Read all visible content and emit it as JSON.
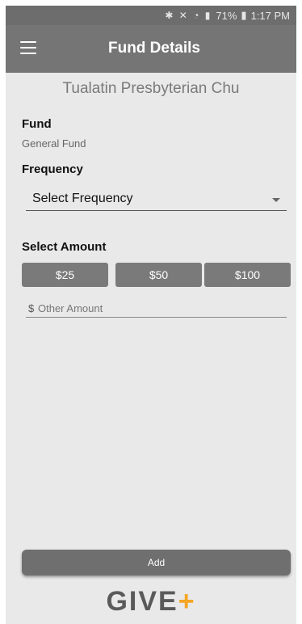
{
  "status_bar": {
    "battery": "71%",
    "time": "1:17 PM",
    "icons": [
      "bluetooth-icon",
      "mute-icon",
      "wifi-icon",
      "lte-icon",
      "signal-icon",
      "battery-icon"
    ]
  },
  "app_bar": {
    "title": "Fund Details",
    "menu_icon": "hamburger-menu-icon"
  },
  "organization": {
    "name": "Tualatin Presbyterian Chu"
  },
  "fund": {
    "label": "Fund",
    "value": "General Fund"
  },
  "frequency": {
    "label": "Frequency",
    "selected": "Select Frequency"
  },
  "amount": {
    "label": "Select Amount",
    "options": [
      "$25",
      "$50",
      "$100"
    ],
    "other_prefix": "$",
    "other_placeholder": "Other Amount"
  },
  "add_button": {
    "label": "Add"
  },
  "brand": {
    "logo_text": "GIVE",
    "logo_plus": "+",
    "accent_color": "#f5a623"
  },
  "colors": {
    "app_bar": "#757575",
    "background": "#e9e9e9",
    "button": "#7a7a7a"
  }
}
